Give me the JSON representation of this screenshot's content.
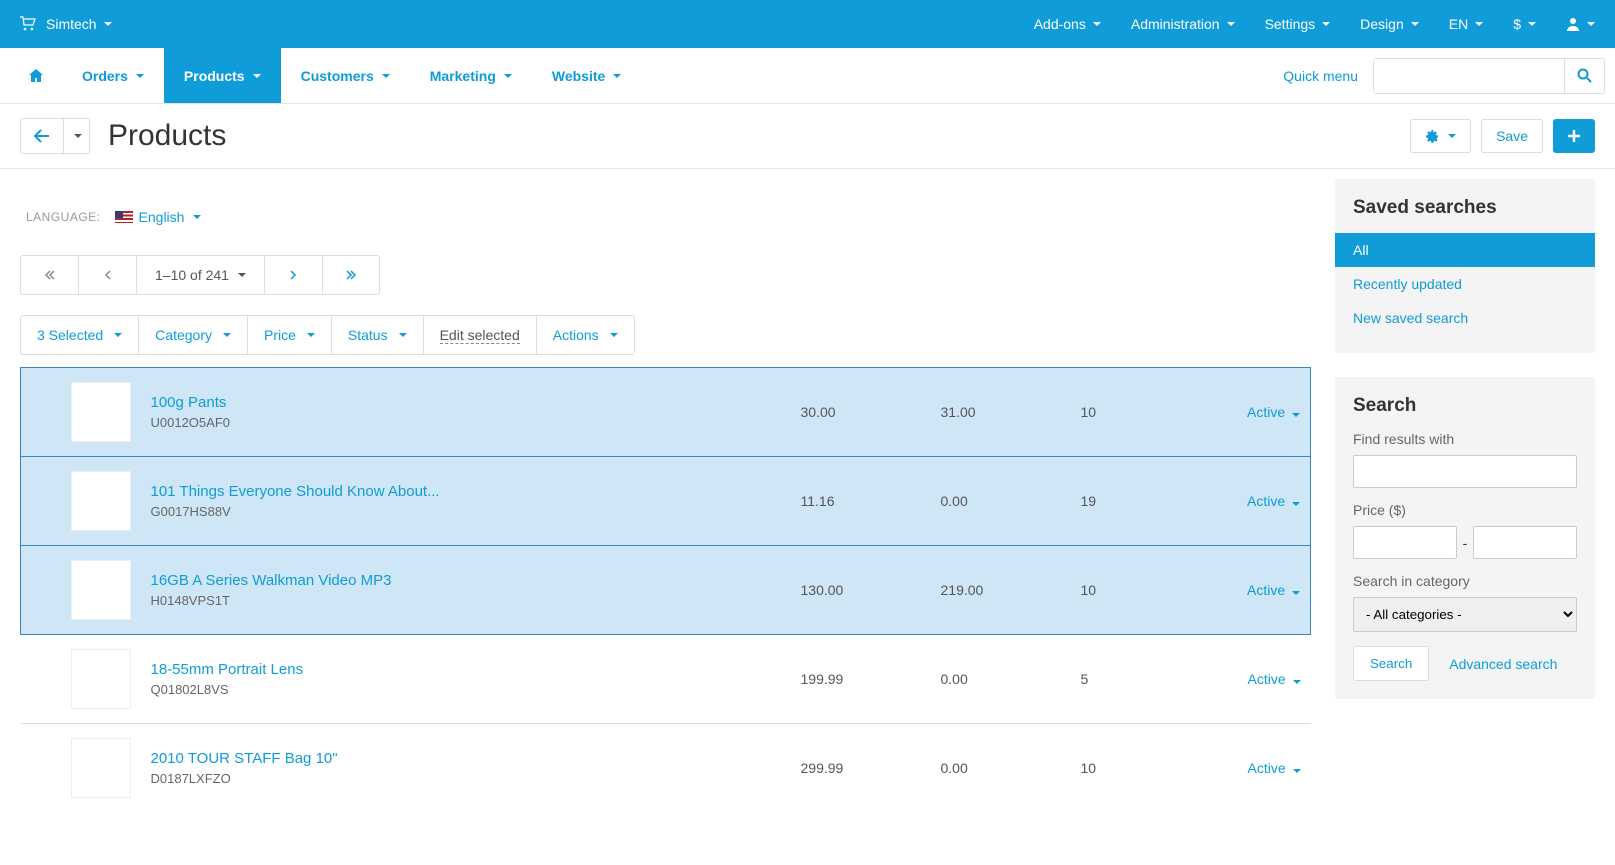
{
  "topbar": {
    "brand": "Simtech",
    "items": [
      "Add-ons",
      "Administration",
      "Settings",
      "Design",
      "EN",
      "$"
    ]
  },
  "mainnav": {
    "items": [
      {
        "label": "Orders",
        "active": false
      },
      {
        "label": "Products",
        "active": true
      },
      {
        "label": "Customers",
        "active": false
      },
      {
        "label": "Marketing",
        "active": false
      },
      {
        "label": "Website",
        "active": false
      }
    ],
    "quick_menu": "Quick menu"
  },
  "pagehead": {
    "title": "Products",
    "save": "Save"
  },
  "language": {
    "label": "LANGUAGE:",
    "value": "English"
  },
  "pagination": {
    "info": "1–10 of 241"
  },
  "filterbar": {
    "selected": "3 Selected",
    "category": "Category",
    "price": "Price",
    "status": "Status",
    "edit": "Edit selected",
    "actions": "Actions"
  },
  "products": [
    {
      "name": "100g Pants",
      "code": "U0012O5AF0",
      "p1": "30.00",
      "p2": "31.00",
      "qty": "10",
      "status": "Active",
      "selected": true
    },
    {
      "name": "101 Things Everyone Should Know About...",
      "code": "G0017HS88V",
      "p1": "11.16",
      "p2": "0.00",
      "qty": "19",
      "status": "Active",
      "selected": true
    },
    {
      "name": "16GB A Series Walkman Video MP3",
      "code": "H0148VPS1T",
      "p1": "130.00",
      "p2": "219.00",
      "qty": "10",
      "status": "Active",
      "selected": true
    },
    {
      "name": "18-55mm Portrait Lens",
      "code": "Q01802L8VS",
      "p1": "199.99",
      "p2": "0.00",
      "qty": "5",
      "status": "Active",
      "selected": false
    },
    {
      "name": "2010 TOUR STAFF Bag 10\"",
      "code": "D0187LXFZO",
      "p1": "299.99",
      "p2": "0.00",
      "qty": "10",
      "status": "Active",
      "selected": false
    }
  ],
  "saved_searches": {
    "title": "Saved searches",
    "items": [
      {
        "label": "All",
        "active": true
      },
      {
        "label": "Recently updated",
        "active": false
      },
      {
        "label": "New saved search",
        "active": false
      }
    ]
  },
  "search_panel": {
    "title": "Search",
    "find_label": "Find results with",
    "price_label": "Price ($)",
    "price_sep": "-",
    "category_label": "Search in category",
    "category_value": "- All categories -",
    "search_btn": "Search",
    "advanced": "Advanced search"
  }
}
